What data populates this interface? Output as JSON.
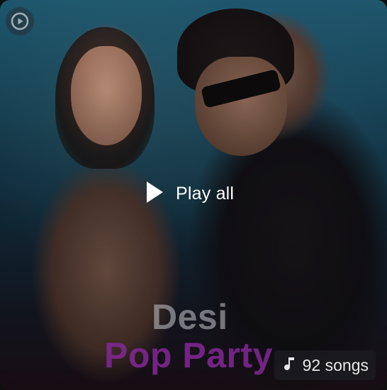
{
  "playlist": {
    "play_all_label": "Play all",
    "title_line1": "Desi",
    "title_line2": "Pop Party",
    "song_count": "92 songs"
  },
  "icons": {
    "corner": "play-circle-icon",
    "play": "play-icon",
    "music": "music-note-icon"
  },
  "colors": {
    "title_line1": "#c8c8cd",
    "title_line2": "#822896",
    "badge_bg": "#1c1c20"
  }
}
